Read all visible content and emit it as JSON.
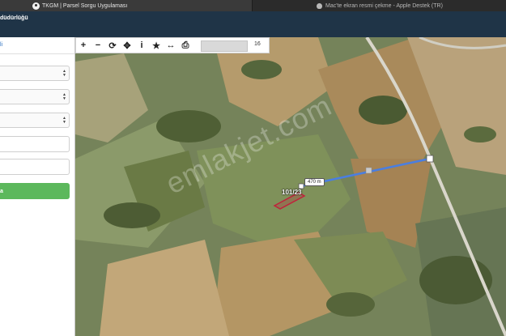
{
  "browser": {
    "active_tab_title": "TKGM | Parsel Sorgu Uygulaması",
    "inactive_tab_title": "Mac'te ekran resmi çekme - Apple Destek (TR)"
  },
  "header": {
    "title_fragment": "düdürlüğü"
  },
  "sidebar": {
    "link_text": "li",
    "select_arrows": "▲▼",
    "button_label": "a"
  },
  "map": {
    "toolbar": {
      "zoom_value": "16",
      "buttons": [
        "+",
        "−",
        "⟳",
        "✥",
        "i",
        "★",
        "↔",
        "⎙"
      ]
    },
    "parcel_label": "101/23",
    "measure_label": "470 m",
    "watermark": "emlakjet.com",
    "colors": {
      "parcel_outline": "#c0223b",
      "measure_line": "#4a7ee0",
      "button_green": "#5cb85c",
      "header_bg": "#1f3447"
    }
  }
}
